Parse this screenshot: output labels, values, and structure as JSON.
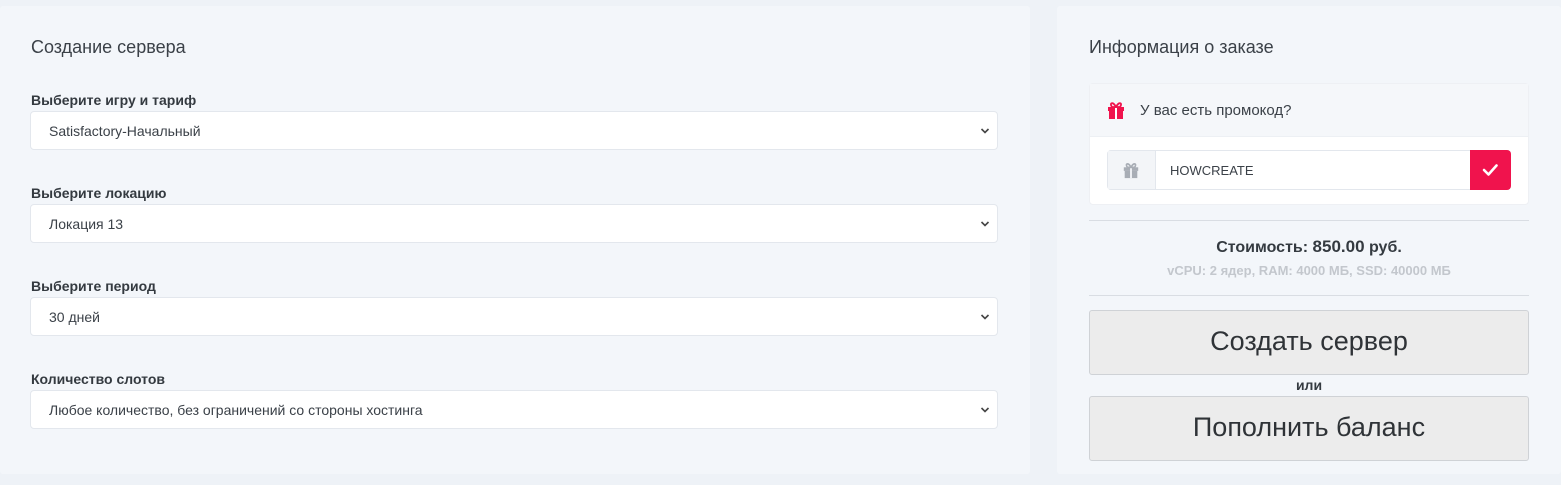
{
  "left": {
    "title": "Создание сервера",
    "fields": [
      {
        "label": "Выберите игру и тариф",
        "value": "Satisfactory-Начальный"
      },
      {
        "label": "Выберите локацию",
        "value": "Локация 13"
      },
      {
        "label": "Выберите период",
        "value": "30 дней"
      },
      {
        "label": "Количество слотов",
        "value": "Любое количество, без ограничений со стороны хостинга"
      }
    ]
  },
  "right": {
    "title": "Информация о заказе",
    "promo": {
      "question": "У вас есть промокод?",
      "value": "HOWCREATE"
    },
    "price": {
      "label": "Стоимость:",
      "amount": "850.00",
      "currency": "руб."
    },
    "specs": "vCPU: 2 ядер, RAM: 4000 МБ, SSD: 40000 МБ",
    "create_button": "Создать сервер",
    "or_text": "или",
    "topup_button": "Пополнить баланс"
  },
  "colors": {
    "accent": "#f0134d",
    "background": "#eef2f7",
    "card": "#f3f6fa"
  },
  "icons": {
    "promo_header": "gift-icon",
    "promo_addon": "gift-icon",
    "apply": "check-icon",
    "select": "chevron-down-icon"
  }
}
